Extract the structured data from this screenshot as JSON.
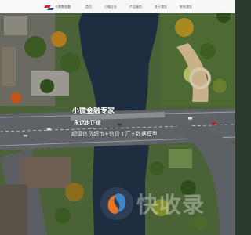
{
  "header": {
    "logo_text": "卡票数金融",
    "nav": [
      "首页",
      "小微企业",
      "产品服务",
      "关于我们",
      "联系我们"
    ]
  },
  "hero": {
    "title": "小微金融专家",
    "slogan": "永远走正道",
    "description": "超级信贷超市+信贷工厂+数据模型"
  },
  "watermark": {
    "text": "快收录"
  },
  "colors": {
    "brand_red": "#d9232e",
    "brand_blue": "#1f4fa3",
    "water": "#1e2e40",
    "bridge": "#8a8e93"
  }
}
